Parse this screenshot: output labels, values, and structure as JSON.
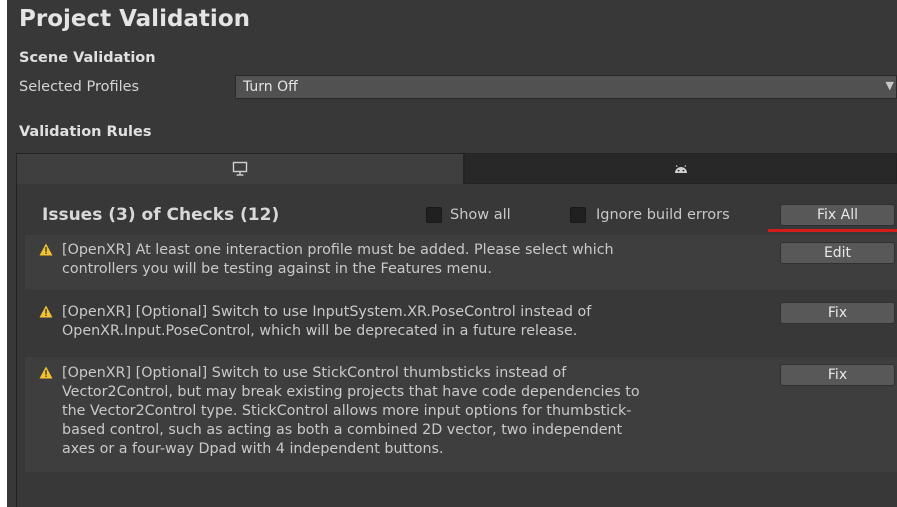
{
  "title": "Project Validation",
  "scene_validation": {
    "heading": "Scene Validation",
    "profiles_label": "Selected Profiles",
    "profiles_value": "Turn Off"
  },
  "validation_rules": {
    "heading": "Validation Rules"
  },
  "tabs": [
    {
      "icon": "monitor-icon",
      "selected": true
    },
    {
      "icon": "android-icon",
      "selected": false
    }
  ],
  "issues": {
    "summary": "Issues (3) of Checks (12)",
    "show_all_label": "Show all",
    "ignore_build_errors_label": "Ignore build errors",
    "fix_all_label": "Fix All",
    "items": [
      {
        "icon": "warning-icon",
        "line1": "[OpenXR] At least one interaction profile must be added.  Please select which",
        "line2": "controllers you will be testing against in the Features menu.",
        "action": "Edit"
      },
      {
        "icon": "warning-icon",
        "line1": "[OpenXR] [Optional] Switch to use InputSystem.XR.PoseControl instead of",
        "line2": "OpenXR.Input.PoseControl, which will be deprecated in a future release.",
        "action": "Fix"
      },
      {
        "icon": "warning-icon",
        "line1": "[OpenXR] [Optional] Switch to use StickControl thumbsticks instead of",
        "line2": "Vector2Control, but may break existing projects that have code dependencies to",
        "line3": "the Vector2Control type. StickControl allows more input options for thumbstick-",
        "line4": "based control, such as acting as both a combined 2D vector, two independent",
        "line5": "axes or a four-way Dpad with 4 independent buttons.",
        "action": "Fix"
      }
    ]
  },
  "colors": {
    "background": "#383838",
    "highlight_underline": "#d21b1b",
    "warning": "#f4c430"
  }
}
